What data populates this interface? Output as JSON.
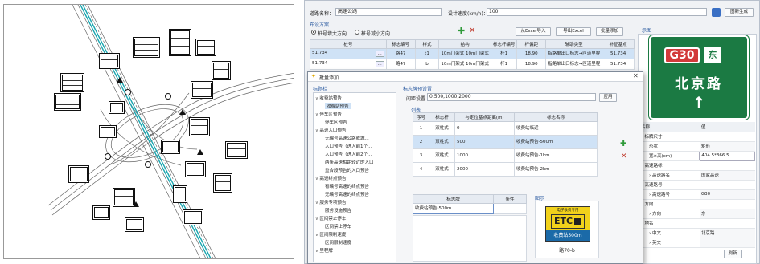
{
  "main": {
    "route_label": "道路名称：",
    "route_value": "高速公路",
    "speed_label": "设计速度(km/h)：",
    "speed_value": "100",
    "settings_button": "图新生成",
    "scheme_title": "布设方案",
    "radio_asc": "桩号增大方向",
    "radio_desc": "桩号减小方向",
    "buttons": {
      "import_excel": "从Excel导入",
      "export_excel": "导出Excel",
      "batch_add": "批量添加"
    },
    "table": {
      "headers": [
        "桩号",
        "标志编号",
        "样式",
        "结构",
        "标志杆编号",
        "杆偏距",
        "辅助类型",
        "补征基点"
      ],
      "rows": [
        [
          "51.734",
          "路47",
          "t1",
          "10m门架式 10m门架式",
          "杆1",
          "18.90",
          "指路单出口标志→匝道里程",
          "51.734"
        ],
        [
          "51.734",
          "路47",
          "b",
          "10m门架式 10m门架式",
          "杆1",
          "18.90",
          "指路单出口标志→匝道里程",
          "51.734"
        ]
      ],
      "ellipsis": "..."
    }
  },
  "dialog": {
    "title": "批量添加",
    "tree_title": "标题栏",
    "tree": [
      {
        "text": "收费站预告",
        "level": 0,
        "expanded": true
      },
      {
        "text": "收费站预告",
        "level": 1,
        "selected": true
      },
      {
        "text": "停车区预告",
        "level": 0,
        "expanded": true
      },
      {
        "text": "停车区预告",
        "level": 1
      },
      {
        "text": "高速入口预告",
        "level": 0,
        "expanded": true
      },
      {
        "text": "无编号高速公路或城...",
        "level": 1
      },
      {
        "text": "入口预告（进入前1个...",
        "level": 1
      },
      {
        "text": "入口预告（进入前2个...",
        "level": 1
      },
      {
        "text": "两条高速相距较近的入口",
        "level": 1
      },
      {
        "text": "重合段预告的入口预告",
        "level": 1
      },
      {
        "text": "高速终点预告",
        "level": 0,
        "expanded": true
      },
      {
        "text": "有编号高速的终点预告",
        "level": 1
      },
      {
        "text": "无编号高速的终点预告",
        "level": 1
      },
      {
        "text": "服务专项预告",
        "level": 0,
        "expanded": true
      },
      {
        "text": "服务设施预告",
        "level": 1
      },
      {
        "text": "区间禁止停车",
        "level": 0,
        "expanded": true
      },
      {
        "text": "区间禁止停车",
        "level": 1
      },
      {
        "text": "区间限制速度",
        "level": 0,
        "expanded": true
      },
      {
        "text": "区间限制速度",
        "level": 1
      },
      {
        "text": "里程牌",
        "level": 0,
        "expanded": true
      }
    ],
    "group_title": "标志牌预设置",
    "spacing_label": "间距设置",
    "spacing_value": "0,500,1000,2000",
    "apply_button": "应用",
    "list_title": "列表",
    "list_headers": [
      "序号",
      "标志杆",
      "与定位基点距离(m)",
      "标志名称"
    ],
    "list_rows": [
      [
        "1",
        "双柱式",
        "0",
        "收费站临近"
      ],
      [
        "2",
        "双柱式",
        "500",
        "收费站预告-500m"
      ],
      [
        "3",
        "双柱式",
        "1000",
        "收费站预告-1km"
      ],
      [
        "4",
        "双柱式",
        "2000",
        "收费站预告-2km"
      ]
    ],
    "name_headers": [
      "标志牌",
      "条件"
    ],
    "name_row": [
      "收费站预告-500m",
      ""
    ],
    "preview_title": "图示",
    "preview": {
      "top_text": "电子收费专用",
      "etc": "ETC",
      "bottom": "收费站500m",
      "caption": "路70-b"
    }
  },
  "side": {
    "title": "示图",
    "sign": {
      "route_code": "G30",
      "direction": "东",
      "city": "北京路"
    },
    "prop_header": [
      "名称",
      "值"
    ],
    "props": [
      {
        "name": "标牌尺寸",
        "value": "",
        "level": 0
      },
      {
        "name": "形状",
        "value": "矩形",
        "level": 1
      },
      {
        "name": "宽×高(cm)",
        "value": "404.5*366.5",
        "level": 1
      },
      {
        "name": "高速路标",
        "value": "",
        "level": 0
      },
      {
        "name": "高速路名",
        "value": "国家高速",
        "level": 1
      },
      {
        "name": "高速路号",
        "value": "",
        "level": 0
      },
      {
        "name": "高速路号",
        "value": "G30",
        "level": 1
      },
      {
        "name": "方向",
        "value": "",
        "level": 0
      },
      {
        "name": "方向",
        "value": "东",
        "level": 1
      },
      {
        "name": "地名",
        "value": "",
        "level": 0
      },
      {
        "name": "中文",
        "value": "北京路",
        "level": 1
      },
      {
        "name": "英文",
        "value": "",
        "level": 1
      }
    ],
    "refresh_button": "刷新"
  },
  "colors": {
    "sign_green": "#1b7a43",
    "etc_yellow": "#f2d21b",
    "selection": "#cfe2f6"
  }
}
